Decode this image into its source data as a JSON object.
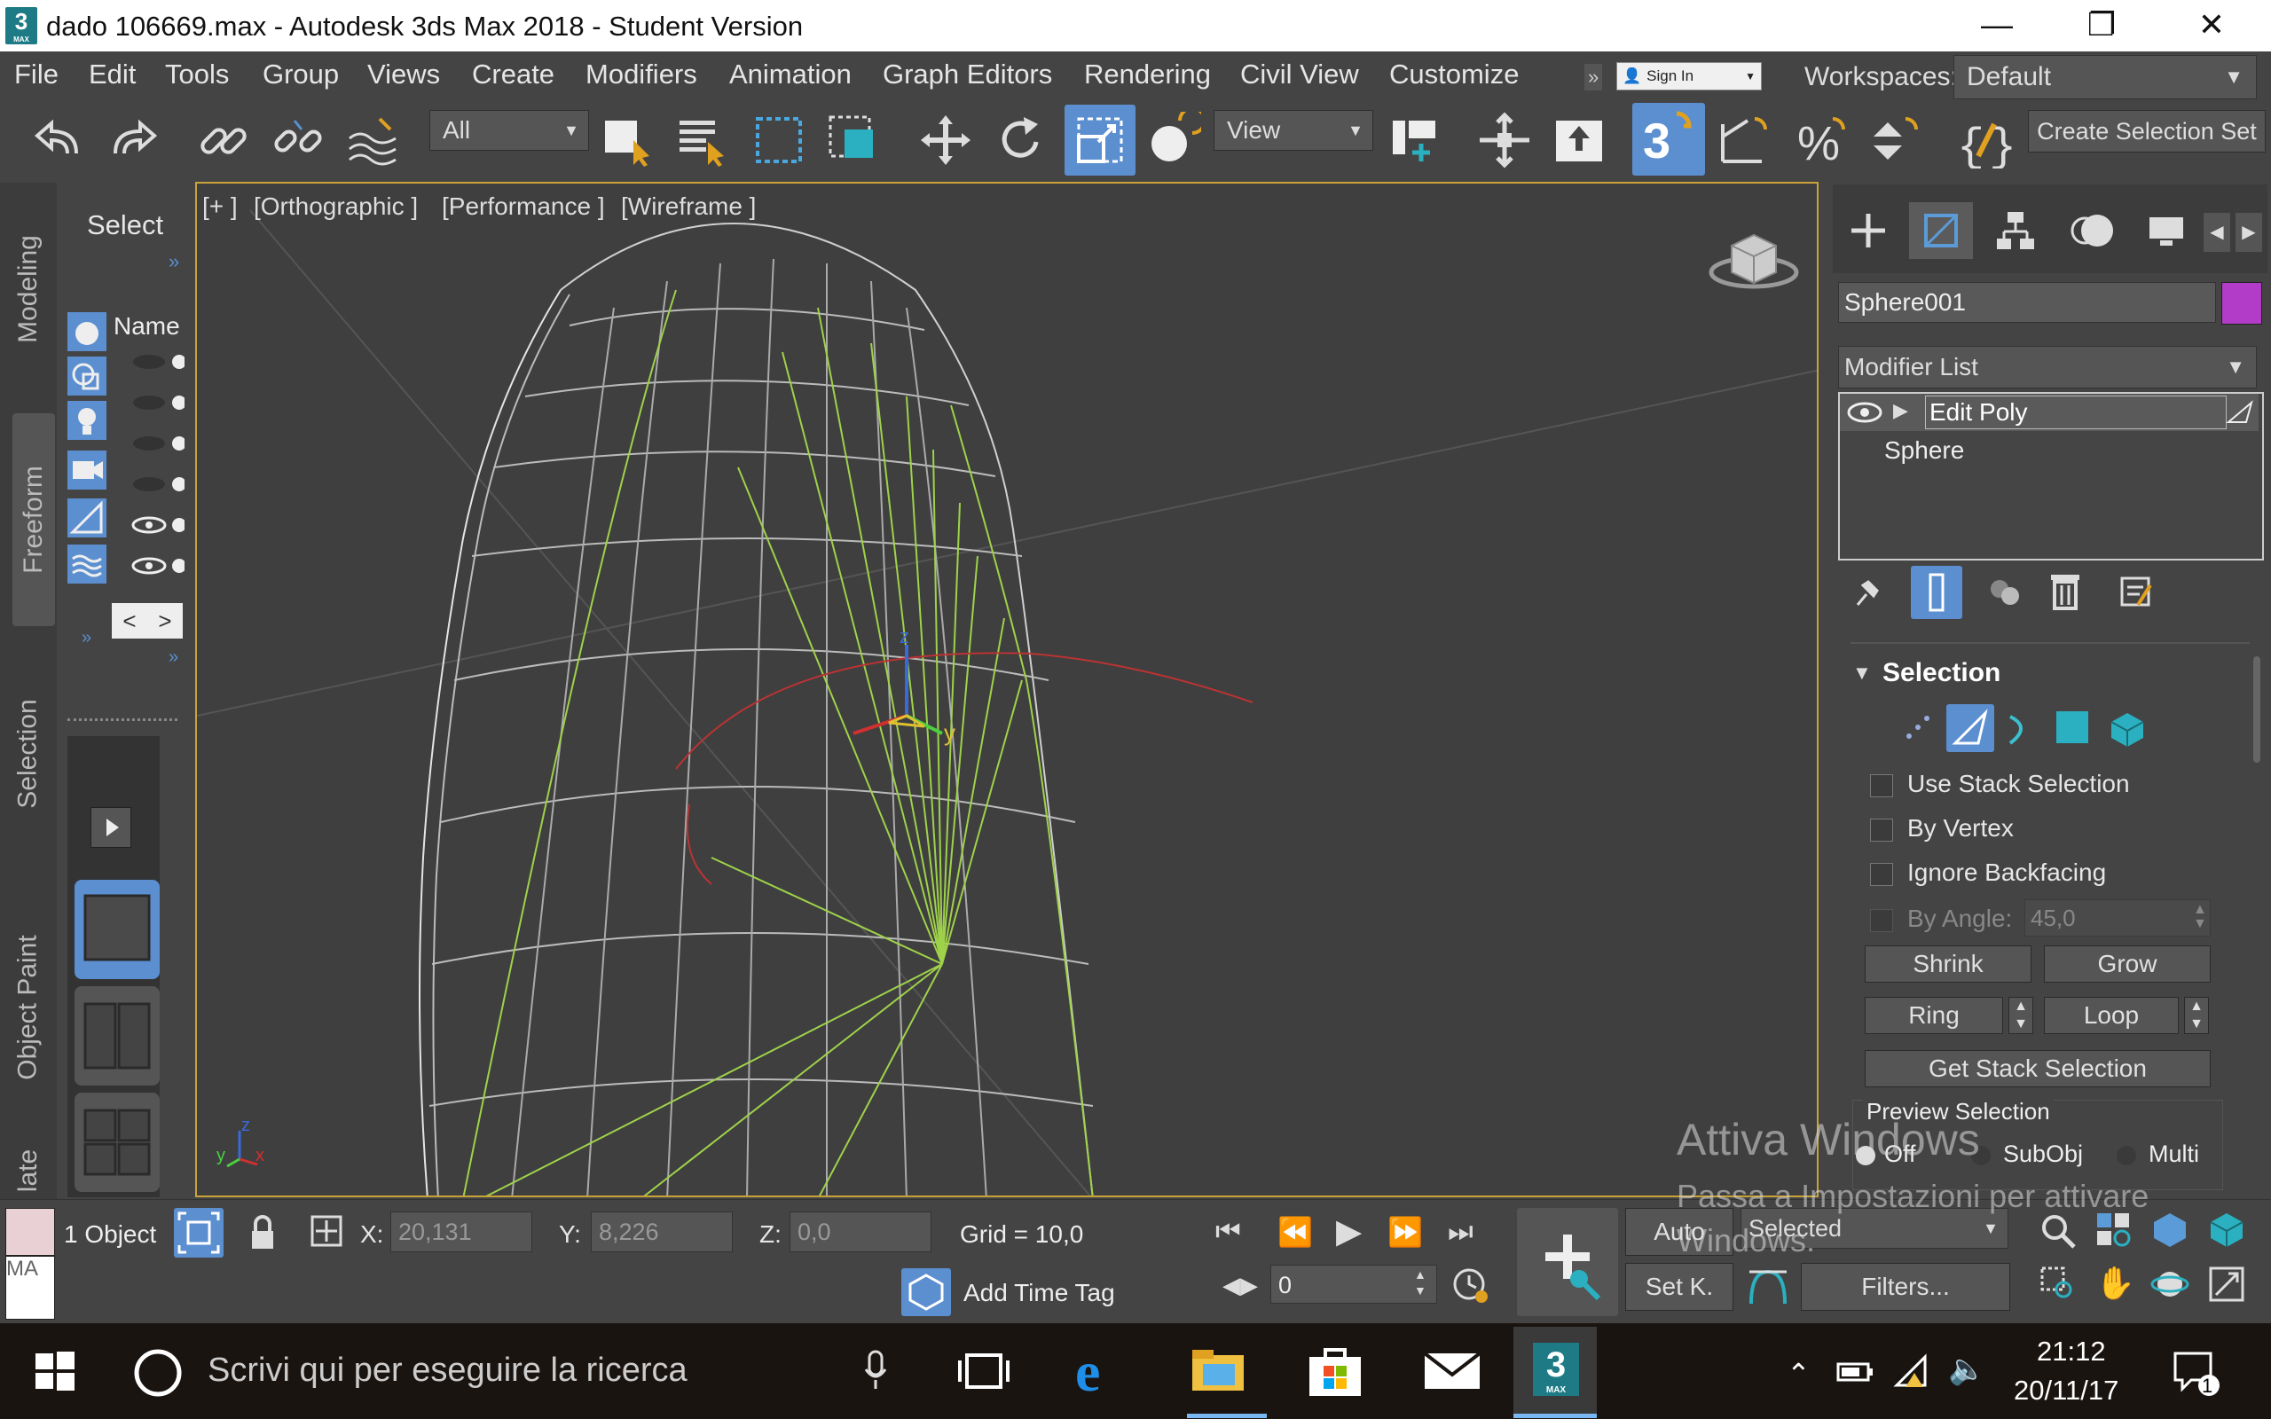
{
  "window": {
    "title": "dado 106669.max - Autodesk 3ds Max 2018 - Student Version",
    "app_icon_text": "3",
    "app_icon_sub": "MAX",
    "minimize": "—",
    "restore": "❐",
    "close": "✕"
  },
  "menu": {
    "items": [
      "File",
      "Edit",
      "Tools",
      "Group",
      "Views",
      "Create",
      "Modifiers",
      "Animation",
      "Graph Editors",
      "Rendering",
      "Civil View",
      "Customize"
    ],
    "overflow": "»",
    "signin": "Sign In",
    "workspaces_label": "Workspaces:",
    "workspace_value": "Default"
  },
  "toolbar": {
    "filter_value": "All",
    "refcoord_value": "View",
    "create_selection_set": "Create Selection Set"
  },
  "ribbon": {
    "tabs": [
      "Modeling",
      "Freeform",
      "Selection",
      "Object Paint",
      "late"
    ]
  },
  "explorer": {
    "header": "Select",
    "name_col": "Name",
    "overflow": "»",
    "nav_prev": "<",
    "nav_next": ">"
  },
  "viewport": {
    "label_plus": "[+ ]",
    "label_view": "[Orthographic ]",
    "label_perf": "[Performance ]",
    "label_shading": "[Wireframe ]",
    "gizmo_z": "z",
    "gizmo_y": "y",
    "axis_x": "x",
    "axis_y": "y",
    "axis_z": "z"
  },
  "command_panel": {
    "object_name": "Sphere001",
    "object_color": "#b23bc8",
    "modifier_list": "Modifier List",
    "stack": [
      "Edit Poly",
      "Sphere"
    ],
    "selection_title": "Selection",
    "use_stack_selection": "Use Stack Selection",
    "by_vertex": "By Vertex",
    "ignore_backfacing": "Ignore Backfacing",
    "by_angle_label": "By Angle:",
    "by_angle_value": "45,0",
    "shrink": "Shrink",
    "grow": "Grow",
    "ring": "Ring",
    "loop": "Loop",
    "get_stack_selection": "Get Stack Selection",
    "preview_selection": "Preview Selection",
    "preview_off": "Off",
    "preview_subobj": "SubObj",
    "preview_multi": "Multi"
  },
  "status": {
    "objects": "1 Object",
    "maxscript": "MA",
    "x_label": "X:",
    "x_value": "20,131",
    "y_label": "Y:",
    "y_value": "8,226",
    "z_label": "Z:",
    "z_value": "0,0",
    "grid": "Grid = 10,0",
    "add_time_tag": "Add Time Tag",
    "frame_value": "0",
    "auto": "Auto",
    "set_key": "Set K.",
    "selected": "Selected",
    "filters": "Filters..."
  },
  "watermark": {
    "line1": "Attiva Windows",
    "line2": "Passa a Impostazioni per attivare",
    "line3": "Windows."
  },
  "taskbar": {
    "search_placeholder": "Scrivi qui per eseguire la ricerca",
    "time": "21:12",
    "date": "20/11/17",
    "notifications": "1",
    "max_icon_text": "3",
    "max_icon_sub": "MAX"
  },
  "colors": {
    "accent_blue": "#5b8fd0",
    "viewport_border": "#c9a33a",
    "wire_white": "#d8d8d8",
    "wire_green": "#9fd24a"
  }
}
